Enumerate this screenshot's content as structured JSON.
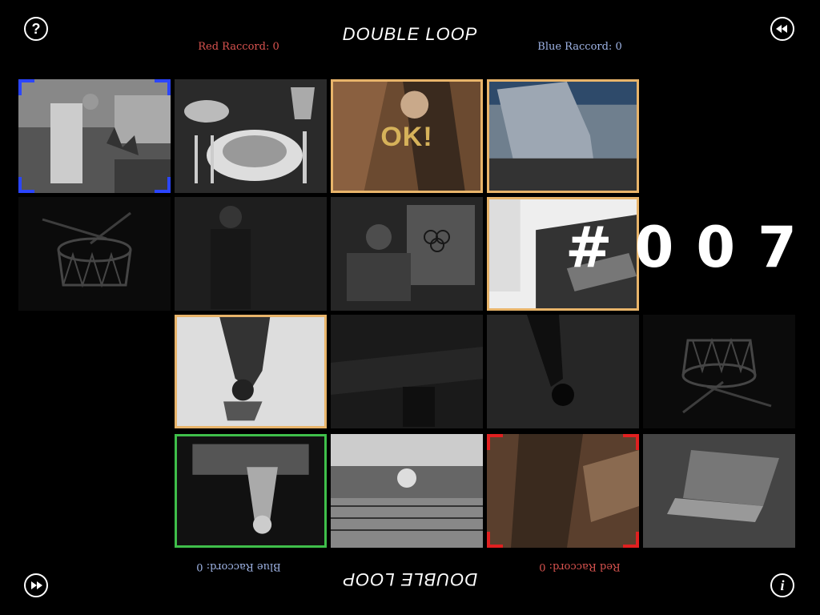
{
  "header": {
    "title": "DOUBLE LOOP",
    "red_score": "Red Raccord: 0",
    "blue_score": "Blue Raccord: 0"
  },
  "footer": {
    "title": "DOUBLE LOOP",
    "red_score": "Red Raccord: 0",
    "blue_score": "Blue Raccord: 0"
  },
  "controls": {
    "help_icon": "question-mark-icon",
    "rewind_icon": "rewind-icon",
    "forward_icon": "fast-forward-icon",
    "info_icon": "info-icon"
  },
  "counter": "#007",
  "tiles": {
    "ok_label": "OK!"
  },
  "colors": {
    "selected_orange": "#e8b46a",
    "selected_green": "#3fbf4a",
    "blue_player": "#2b45ff",
    "red_player": "#e02020"
  }
}
